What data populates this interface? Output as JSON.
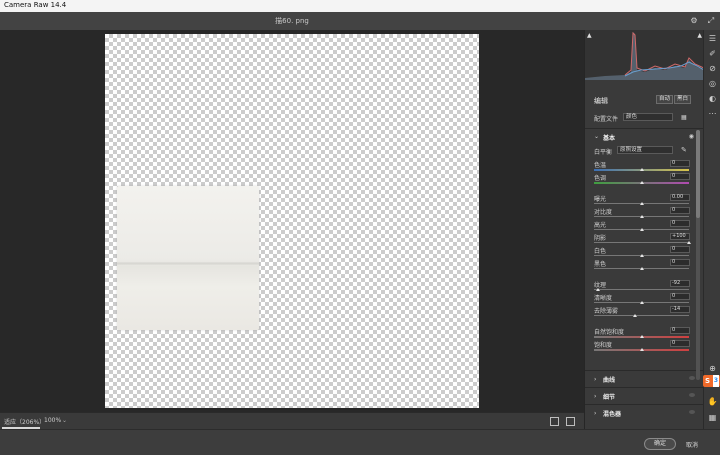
{
  "app": {
    "title": "Camera Raw 14.4"
  },
  "document": {
    "filename": "描60. png"
  },
  "status": {
    "zoom_fit": "适应（206%）",
    "zoom_value": "100%"
  },
  "footer": {
    "ok": "确定",
    "cancel": "取消"
  },
  "panel": {
    "edit_title": "编辑",
    "auto": "自动",
    "bw": "黑白",
    "profile_label": "配置文件",
    "profile_value": "颜色",
    "basic_title": "基本",
    "white_balance_label": "白平衡",
    "white_balance_value": "原照设置",
    "sliders": [
      {
        "label": "色温",
        "value": "0",
        "level": 0.5
      },
      {
        "label": "色调",
        "value": "0",
        "level": 0.5
      },
      {
        "label": "曝光",
        "value": "0.00",
        "level": 0.5
      },
      {
        "label": "对比度",
        "value": "0",
        "level": 0.5
      },
      {
        "label": "高光",
        "value": "0",
        "level": 0.5
      },
      {
        "label": "阴影",
        "value": "+100",
        "level": 1.0
      },
      {
        "label": "白色",
        "value": "0",
        "level": 0.5
      },
      {
        "label": "黑色",
        "value": "0",
        "level": 0.5
      },
      {
        "label": "纹理",
        "value": "-92",
        "level": 0.04
      },
      {
        "label": "清晰度",
        "value": "0",
        "level": 0.5
      },
      {
        "label": "去除薄雾",
        "value": "-14",
        "level": 0.43
      },
      {
        "label": "自然饱和度",
        "value": "0",
        "level": 0.5
      },
      {
        "label": "饱和度",
        "value": "0",
        "level": 0.5
      }
    ],
    "sections": [
      "曲线",
      "细节",
      "混色器"
    ]
  },
  "tools": [
    "edit-sliders-icon",
    "brush-icon",
    "heal-icon",
    "redeye-icon",
    "mask-icon",
    "more-icon"
  ],
  "ime": {
    "label": "S",
    "num": "3"
  },
  "colors": {
    "accent": "#e5e5e5",
    "panel_bg": "#3a3a3a",
    "canvas_bg": "#282828"
  }
}
